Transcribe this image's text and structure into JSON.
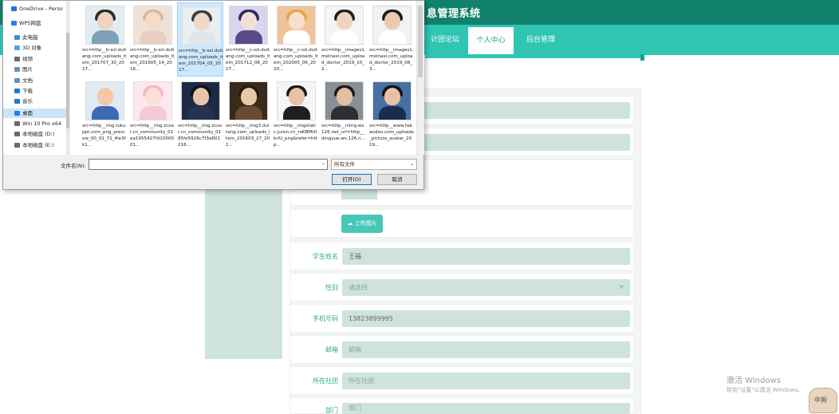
{
  "app": {
    "title": "息管理系统",
    "nav": [
      {
        "label": "计团论坛"
      },
      {
        "label": "个人中心"
      },
      {
        "label": "后台管理"
      }
    ]
  },
  "form": {
    "upload_label": "上传图片",
    "fields": [
      {
        "label": "学生姓名",
        "value": "王福"
      },
      {
        "label": "性别",
        "value": "请选择"
      },
      {
        "label": "手机号码",
        "value": "13823899995"
      },
      {
        "label": "邮箱",
        "value": "邮箱"
      },
      {
        "label": "所在社团",
        "value": "所在社团"
      },
      {
        "label": "部门",
        "value": "部门"
      }
    ]
  },
  "os": {
    "activate_title": "激活 Windows",
    "activate_sub": "转到\"设置\"以激活 Windows。",
    "mascot_text": "中狗"
  },
  "dialog": {
    "sidebar": [
      {
        "label": "OneDrive - Perso",
        "icon": "cloud-icon",
        "color": "#1e77d4"
      },
      {
        "label": "WPS网盘",
        "icon": "cloud-icon",
        "color": "#2b7de9"
      },
      {
        "label": "此电脑",
        "icon": "computer-icon",
        "color": "#3c8fd6"
      },
      {
        "label": "3D 对象",
        "icon": "cube-icon",
        "color": "#5aa0e0"
      },
      {
        "label": "视频",
        "icon": "video-icon",
        "color": "#6a6a6a"
      },
      {
        "label": "图片",
        "icon": "picture-icon",
        "color": "#6a8fb5"
      },
      {
        "label": "文档",
        "icon": "document-icon",
        "color": "#6a8fb5"
      },
      {
        "label": "下载",
        "icon": "download-icon",
        "color": "#1e77d4"
      },
      {
        "label": "音乐",
        "icon": "music-icon",
        "color": "#1e77d4"
      },
      {
        "label": "桌面",
        "icon": "desktop-icon",
        "color": "#2b7de9"
      },
      {
        "label": "Win 10 Pro x64",
        "icon": "drive-icon",
        "color": "#6a6a6a"
      },
      {
        "label": "本地磁盘 (D:)",
        "icon": "drive-icon",
        "color": "#6a6a6a"
      },
      {
        "label": "本地磁盘 (E:)",
        "icon": "drive-icon",
        "color": "#6a6a6a"
      }
    ],
    "files": [
      {
        "name": "src=http__b-ssl.duitang.com_uploads_item_201707_30_2017...",
        "bg": "#e3ecf0",
        "skin": "#f1d2bd",
        "hair": "#2b2b2b",
        "cloth": "#7ea1b9"
      },
      {
        "name": "src=http__b-ssl.duitang.com_uploads_item_201605_14_2016...",
        "bg": "#efe3d8",
        "skin": "#f6dbc7",
        "hair": "#d9b8a0",
        "cloth": "#e8cfc0"
      },
      {
        "name": "src=http__b-ssl.duitang.com_uploads_item_201704_05_2017...",
        "bg": "#e9eef0",
        "skin": "#efd8c6",
        "hair": "#3b3b3b",
        "cloth": "#dfe7ea"
      },
      {
        "name": "src=http__c-ssl.duitang.com_uploads_item_201712_08_2017...",
        "bg": "#d9d5ee",
        "skin": "#f4dfd8",
        "hair": "#2d2a5c",
        "cloth": "#5a4a8a"
      },
      {
        "name": "src=http__c-ssl.duitang.com_uploads_item_202005_06_2020...",
        "bg": "#f0c49b",
        "skin": "#f8dfcd",
        "hair": "#e8a24a",
        "cloth": "#ffffff"
      },
      {
        "name": "src=http__images1.meinaxi.com_upload_doctor_2019_10_2...",
        "bg": "#f4f4f4",
        "skin": "#f0d3c2",
        "hair": "#202020",
        "cloth": "#ffffff"
      },
      {
        "name": "src=http__images1.meinaxi.com_upload_doctor_2019_08_3...",
        "bg": "#f2f2f2",
        "skin": "#ebc9b3",
        "hair": "#1a1a1a",
        "cloth": "#ffffff"
      },
      {
        "name": "src=http__img.tukuppt.com_png_preview_00_02_71_4le3fk1...",
        "bg": "#dfeaf4",
        "skin": "#f2c8a8",
        "hair": "#e8e8e8",
        "cloth": "#3b6bb5"
      },
      {
        "name": "src=http__img.zcool.cn_community_01ea1955427fd1000001...",
        "bg": "#fde8ee",
        "skin": "#fbe0d4",
        "hair": "#f2b7c5",
        "cloth": "#f7c9d6"
      },
      {
        "name": "src=http__img.zcool.cn_community_0185fe5926c7f3a801216...",
        "bg": "#1d2a45",
        "skin": "#e6c4ab",
        "hair": "#111111",
        "cloth": "#26334f"
      },
      {
        "name": "src=http__img3.duitang.com_uploads_item_201603_27_201...",
        "bg": "#3a2a1c",
        "skin": "#e8c9a6",
        "hair": "#2a1a10",
        "cloth": "#6a4a30"
      },
      {
        "name": "src=http__imgstatic.juren.cn_roKBMUtkriU_png&refer=http...",
        "bg": "#f5f5f5",
        "skin": "#e7c2a9",
        "hair": "#1a1a1a",
        "cloth": "#1f1f1f"
      },
      {
        "name": "src=http__nimg.ws.126.net_url=http__dingyue.ws.126.n...",
        "bg": "#8a8f96",
        "skin": "#e3bfa2",
        "hair": "#1a1a1a",
        "cloth": "#2b2e33"
      },
      {
        "name": "src=http__www.fabaodou.com_uploads_picture_avatar_2019...",
        "bg": "#4a6fa5",
        "skin": "#e6c1a3",
        "hair": "#111111",
        "cloth": "#1c2c4e"
      }
    ],
    "filename_label": "文件名(N):",
    "filename_value": "",
    "filetype": "所有文件",
    "open_label": "打开(O)",
    "cancel_label": "取消"
  }
}
